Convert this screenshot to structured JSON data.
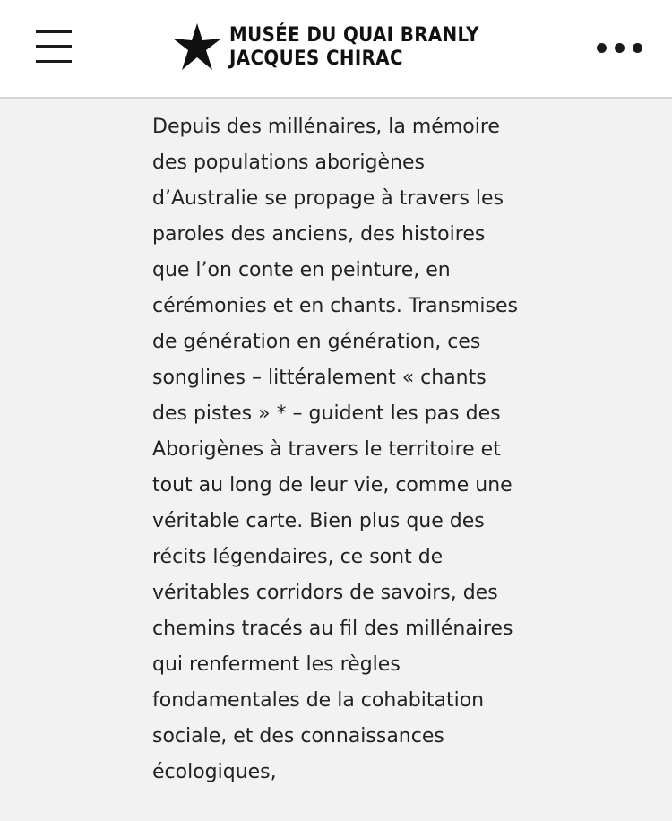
{
  "header": {
    "menu_icon": "hamburger-menu-icon",
    "logo": {
      "icon": "star-logo-icon",
      "line1": "MUSÉE DU QUAI BRANLY",
      "line2": "JACQUES CHIRAC"
    },
    "more_icon": "more-options-icon"
  },
  "article": {
    "paragraph": "Depuis des millénaires, la mémoire des populations aborigènes d’Australie se propage à travers les paroles des anciens, des histoires que l’on conte en peinture, en cérémonies et en chants. Transmises de génération en génération, ces songlines – littéralement « chants des pistes » * – guident les pas des Aborigènes à travers le territoire et tout au long de leur vie, comme une véritable carte. Bien plus que des récits légendaires, ce sont de véritables corridors de savoirs, des chemins tracés au fil des millénaires qui renferment les règles fondamentales de la cohabitation sociale, et des connaissances écologiques,"
  },
  "colors": {
    "header_background": "#ffffff",
    "page_background": "#f2f2f2",
    "text": "#222222"
  }
}
